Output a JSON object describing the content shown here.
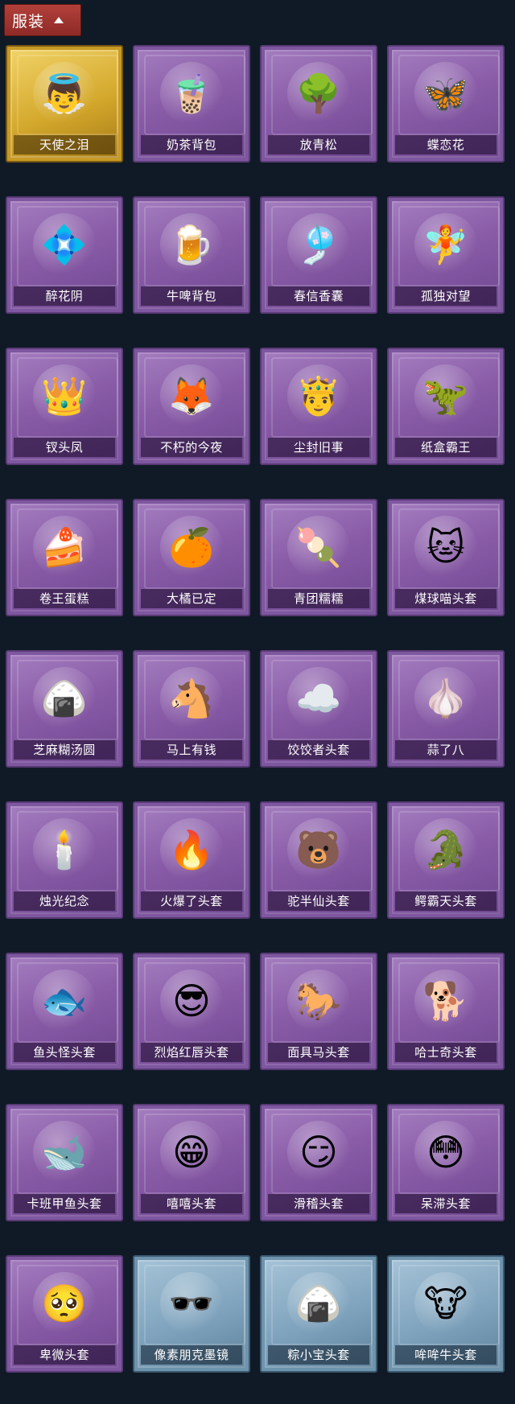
{
  "header": {
    "label": "服装"
  },
  "items": [
    {
      "label": "天使之泪",
      "icon": "angel-icon",
      "glyph": "👼",
      "tier": "gold"
    },
    {
      "label": "奶茶背包",
      "icon": "milk-tea-icon",
      "glyph": "🧋",
      "tier": "purple"
    },
    {
      "label": "放青松",
      "icon": "bonsai-icon",
      "glyph": "🌳",
      "tier": "purple"
    },
    {
      "label": "蝶恋花",
      "icon": "flower-wreath-icon",
      "glyph": "🦋",
      "tier": "purple"
    },
    {
      "label": "醉花阴",
      "icon": "flower-charm-icon",
      "glyph": "💠",
      "tier": "purple"
    },
    {
      "label": "牛啤背包",
      "icon": "beer-barrel-icon",
      "glyph": "🍺",
      "tier": "purple"
    },
    {
      "label": "春信香囊",
      "icon": "sachet-icon",
      "glyph": "🎐",
      "tier": "purple"
    },
    {
      "label": "孤独对望",
      "icon": "figure-charm-icon",
      "glyph": "🧚",
      "tier": "purple"
    },
    {
      "label": "钗头凤",
      "icon": "crown-doll-icon",
      "glyph": "👑",
      "tier": "purple"
    },
    {
      "label": "不朽的今夜",
      "icon": "fox-cup-icon",
      "glyph": "🦊",
      "tier": "purple"
    },
    {
      "label": "尘封旧事",
      "icon": "doll-charm-icon",
      "glyph": "🤴",
      "tier": "purple"
    },
    {
      "label": "纸盒霸王",
      "icon": "box-dino-icon",
      "glyph": "🦖",
      "tier": "purple"
    },
    {
      "label": "卷王蛋糕",
      "icon": "roll-cake-icon",
      "glyph": "🍰",
      "tier": "purple"
    },
    {
      "label": "大橘已定",
      "icon": "orange-icon",
      "glyph": "🍊",
      "tier": "purple"
    },
    {
      "label": "青团糯糯",
      "icon": "rice-ball-icon",
      "glyph": "🍡",
      "tier": "purple"
    },
    {
      "label": "煤球喵头套",
      "icon": "black-cat-icon",
      "glyph": "🐱",
      "tier": "purple"
    },
    {
      "label": "芝麻糊汤圆",
      "icon": "dumpling-icon",
      "glyph": "🍙",
      "tier": "purple"
    },
    {
      "label": "马上有钱",
      "icon": "horse-icon",
      "glyph": "🐴",
      "tier": "purple"
    },
    {
      "label": "饺饺者头套",
      "icon": "cloud-dumpling-icon",
      "glyph": "☁️",
      "tier": "purple"
    },
    {
      "label": "蒜了八",
      "icon": "garlic-icon",
      "glyph": "🧄",
      "tier": "purple"
    },
    {
      "label": "烛光纪念",
      "icon": "candle-icon",
      "glyph": "🕯️",
      "tier": "purple"
    },
    {
      "label": "火爆了头套",
      "icon": "fire-icon",
      "glyph": "🔥",
      "tier": "purple"
    },
    {
      "label": "驼半仙头套",
      "icon": "bear-glasses-icon",
      "glyph": "🐻",
      "tier": "purple"
    },
    {
      "label": "鳄霸天头套",
      "icon": "crocodile-icon",
      "glyph": "🐊",
      "tier": "purple"
    },
    {
      "label": "鱼头怪头套",
      "icon": "fish-head-icon",
      "glyph": "🐟",
      "tier": "purple"
    },
    {
      "label": "烈焰红唇头套",
      "icon": "yellow-mask-icon",
      "glyph": "😎",
      "tier": "purple"
    },
    {
      "label": "面具马头套",
      "icon": "horse-mask-icon",
      "glyph": "🐎",
      "tier": "purple"
    },
    {
      "label": "哈士奇头套",
      "icon": "husky-icon",
      "glyph": "🐕",
      "tier": "purple"
    },
    {
      "label": "卡班甲鱼头套",
      "icon": "turtle-icon",
      "glyph": "🐋",
      "tier": "purple"
    },
    {
      "label": "嘻嘻头套",
      "icon": "grin-emoji-icon",
      "glyph": "😁",
      "tier": "purple"
    },
    {
      "label": "滑稽头套",
      "icon": "funny-emoji-icon",
      "glyph": "😏",
      "tier": "purple"
    },
    {
      "label": "呆滞头套",
      "icon": "stare-emoji-icon",
      "glyph": "😳",
      "tier": "purple"
    },
    {
      "label": "卑微头套",
      "icon": "humble-emoji-icon",
      "glyph": "🥺",
      "tier": "purple"
    },
    {
      "label": "像素朋克墨镜",
      "icon": "pixel-sunglasses-icon",
      "glyph": "🕶️",
      "tier": "blue"
    },
    {
      "label": "粽小宝头套",
      "icon": "zongzi-icon",
      "glyph": "🍙",
      "tier": "blue"
    },
    {
      "label": "哞哞牛头套",
      "icon": "cow-icon",
      "glyph": "🐮",
      "tier": "blue"
    }
  ]
}
